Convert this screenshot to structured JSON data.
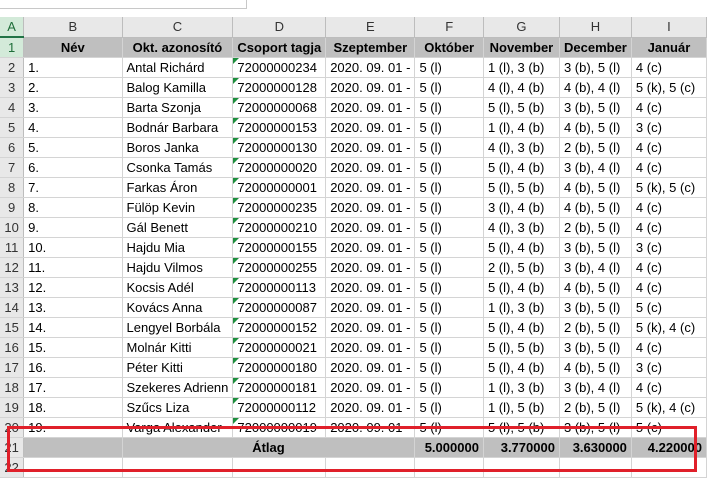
{
  "sheet": {
    "columns": [
      "A",
      "B",
      "C",
      "D",
      "E",
      "F",
      "G",
      "H",
      "I"
    ],
    "header_row_num": "1",
    "headers": [
      "#",
      "Név",
      "Okt. azonosító",
      "Csoport tagja",
      "Szeptember",
      "Október",
      "November",
      "December",
      "Január"
    ],
    "rows": [
      {
        "n": "2",
        "idx": "1.",
        "name": "Antal Richárd",
        "id": "72000000234",
        "group": "2020. 09. 01 -",
        "sep": "5 (l)",
        "oct": "1 (l), 3 (b)",
        "nov": "3 (b), 5 (l)",
        "dec": "4 (c)"
      },
      {
        "n": "3",
        "idx": "2.",
        "name": "Balog Kamilla",
        "id": "72000000128",
        "group": "2020. 09. 01 -",
        "sep": "5 (l)",
        "oct": "4 (l), 4 (b)",
        "nov": "4 (b), 4 (l)",
        "dec": "5 (k), 5 (c)"
      },
      {
        "n": "4",
        "idx": "3.",
        "name": "Barta Szonja",
        "id": "72000000068",
        "group": "2020. 09. 01 -",
        "sep": "5 (l)",
        "oct": "5 (l), 5 (b)",
        "nov": "3 (b), 5 (l)",
        "dec": "4 (c)"
      },
      {
        "n": "5",
        "idx": "4.",
        "name": "Bodnár Barbara",
        "id": "72000000153",
        "group": "2020. 09. 01 -",
        "sep": "5 (l)",
        "oct": "1 (l), 4 (b)",
        "nov": "4 (b), 5 (l)",
        "dec": "3 (c)"
      },
      {
        "n": "6",
        "idx": "5.",
        "name": "Boros Janka",
        "id": "72000000130",
        "group": "2020. 09. 01 -",
        "sep": "5 (l)",
        "oct": "4 (l), 3 (b)",
        "nov": "2 (b), 5 (l)",
        "dec": "4 (c)"
      },
      {
        "n": "7",
        "idx": "6.",
        "name": "Csonka Tamás",
        "id": "72000000020",
        "group": "2020. 09. 01 -",
        "sep": "5 (l)",
        "oct": "5 (l), 4 (b)",
        "nov": "3 (b), 4 (l)",
        "dec": "4 (c)"
      },
      {
        "n": "8",
        "idx": "7.",
        "name": "Farkas Áron",
        "id": "72000000001",
        "group": "2020. 09. 01 -",
        "sep": "5 (l)",
        "oct": "5 (l), 5 (b)",
        "nov": "4 (b), 5 (l)",
        "dec": "5 (k), 5 (c)"
      },
      {
        "n": "9",
        "idx": "8.",
        "name": "Fülöp Kevin",
        "id": "72000000235",
        "group": "2020. 09. 01 -",
        "sep": "5 (l)",
        "oct": "3 (l), 4 (b)",
        "nov": "4 (b), 5 (l)",
        "dec": "4 (c)"
      },
      {
        "n": "10",
        "idx": "9.",
        "name": "Gál Benett",
        "id": "72000000210",
        "group": "2020. 09. 01 -",
        "sep": "5 (l)",
        "oct": "4 (l), 3 (b)",
        "nov": "2 (b), 5 (l)",
        "dec": "4 (c)"
      },
      {
        "n": "11",
        "idx": "10.",
        "name": "Hajdu Mia",
        "id": "72000000155",
        "group": "2020. 09. 01 -",
        "sep": "5 (l)",
        "oct": "5 (l), 4 (b)",
        "nov": "3 (b), 5 (l)",
        "dec": "3 (c)"
      },
      {
        "n": "12",
        "idx": "11.",
        "name": "Hajdu Vilmos",
        "id": "72000000255",
        "group": "2020. 09. 01 -",
        "sep": "5 (l)",
        "oct": "2 (l), 5 (b)",
        "nov": "3 (b), 4 (l)",
        "dec": "4 (c)"
      },
      {
        "n": "13",
        "idx": "12.",
        "name": "Kocsis Adél",
        "id": "72000000113",
        "group": "2020. 09. 01 -",
        "sep": "5 (l)",
        "oct": "5 (l), 4 (b)",
        "nov": "4 (b), 5 (l)",
        "dec": "4 (c)"
      },
      {
        "n": "14",
        "idx": "13.",
        "name": "Kovács Anna",
        "id": "72000000087",
        "group": "2020. 09. 01 -",
        "sep": "5 (l)",
        "oct": "1 (l), 3 (b)",
        "nov": "3 (b), 5 (l)",
        "dec": "5 (c)"
      },
      {
        "n": "15",
        "idx": "14.",
        "name": "Lengyel Borbála",
        "id": "72000000152",
        "group": "2020. 09. 01 -",
        "sep": "5 (l)",
        "oct": "5 (l), 4 (b)",
        "nov": "2 (b), 5 (l)",
        "dec": "5 (k), 4 (c)"
      },
      {
        "n": "16",
        "idx": "15.",
        "name": "Molnár Kitti",
        "id": "72000000021",
        "group": "2020. 09. 01 -",
        "sep": "5 (l)",
        "oct": "5 (l), 5 (b)",
        "nov": "3 (b), 5 (l)",
        "dec": "4 (c)"
      },
      {
        "n": "17",
        "idx": "16.",
        "name": "Péter Kitti",
        "id": "72000000180",
        "group": "2020. 09. 01 -",
        "sep": "5 (l)",
        "oct": "5 (l), 4 (b)",
        "nov": "4 (b), 5 (l)",
        "dec": "3 (c)"
      },
      {
        "n": "18",
        "idx": "17.",
        "name": "Szekeres Adrienn",
        "id": "72000000181",
        "group": "2020. 09. 01 -",
        "sep": "5 (l)",
        "oct": "1 (l), 3 (b)",
        "nov": "3 (b), 4 (l)",
        "dec": "4 (c)"
      },
      {
        "n": "19",
        "idx": "18.",
        "name": "Szűcs Liza",
        "id": "72000000112",
        "group": "2020. 09. 01 -",
        "sep": "5 (l)",
        "oct": "1 (l), 5 (b)",
        "nov": "2 (b), 5 (l)",
        "dec": "5 (k), 4 (c)"
      },
      {
        "n": "20",
        "idx": "19.",
        "name": "Varga Alexander",
        "id": "72000000019",
        "group": "2020. 09. 01 -",
        "sep": "5 (l)",
        "oct": "5 (l), 5 (b)",
        "nov": "3 (b), 5 (l)",
        "dec": "5 (c)"
      }
    ],
    "average": {
      "n": "21",
      "label": "Átlag",
      "sep": "5.000000",
      "oct": "3.770000",
      "nov": "3.630000",
      "dec": "4.220000"
    },
    "row22": "22",
    "highlight_color": "#e0202a",
    "header_fill": "#bfbfbf",
    "selection_color": "#217346"
  }
}
